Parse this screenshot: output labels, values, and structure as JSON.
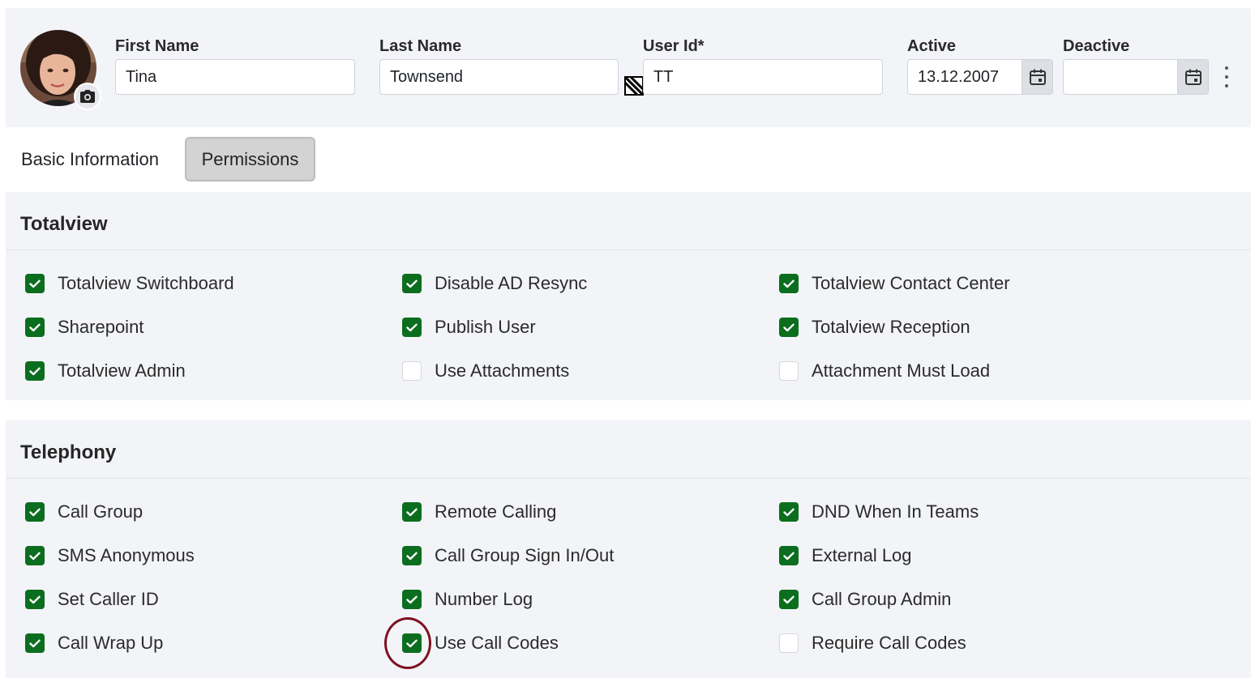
{
  "header": {
    "first_name": {
      "label": "First Name",
      "value": "Tina"
    },
    "last_name": {
      "label": "Last Name",
      "value": "Townsend"
    },
    "user_id": {
      "label": "User Id*",
      "value": "TT"
    },
    "active": {
      "label": "Active",
      "value": "13.12.2007"
    },
    "deactive": {
      "label": "Deactive",
      "value": ""
    }
  },
  "tabs": [
    {
      "label": "Basic Information",
      "selected": false
    },
    {
      "label": "Permissions",
      "selected": true
    }
  ],
  "sections": [
    {
      "title": "Totalview",
      "items": [
        {
          "label": "Totalview Switchboard",
          "checked": true
        },
        {
          "label": "Disable AD Resync",
          "checked": true
        },
        {
          "label": "Totalview Contact Center",
          "checked": true
        },
        {
          "label": "Sharepoint",
          "checked": true
        },
        {
          "label": "Publish User",
          "checked": true
        },
        {
          "label": "Totalview Reception",
          "checked": true
        },
        {
          "label": "Totalview Admin",
          "checked": true
        },
        {
          "label": "Use Attachments",
          "checked": false
        },
        {
          "label": "Attachment Must Load",
          "checked": false
        }
      ]
    },
    {
      "title": "Telephony",
      "items": [
        {
          "label": "Call Group",
          "checked": true
        },
        {
          "label": "Remote Calling",
          "checked": true
        },
        {
          "label": "DND When In Teams",
          "checked": true
        },
        {
          "label": "SMS Anonymous",
          "checked": true
        },
        {
          "label": "Call Group Sign In/Out",
          "checked": true
        },
        {
          "label": "External Log",
          "checked": true
        },
        {
          "label": "Set Caller ID",
          "checked": true
        },
        {
          "label": "Number Log",
          "checked": true
        },
        {
          "label": "Call Group Admin",
          "checked": true
        },
        {
          "label": "Call Wrap Up",
          "checked": true
        },
        {
          "label": "Use Call Codes",
          "checked": true
        },
        {
          "label": "Require Call Codes",
          "checked": false
        }
      ]
    }
  ],
  "colors": {
    "checkbox_checked": "#0b6e1f",
    "panel_bg": "#f3f4f7",
    "highlight_ring": "#7d1220"
  },
  "icons": {
    "camera": "camera-icon",
    "calendar": "calendar-icon",
    "ad_sync": "ad-sync-icon",
    "more": "more-vertical-icon",
    "check": "check-icon"
  }
}
